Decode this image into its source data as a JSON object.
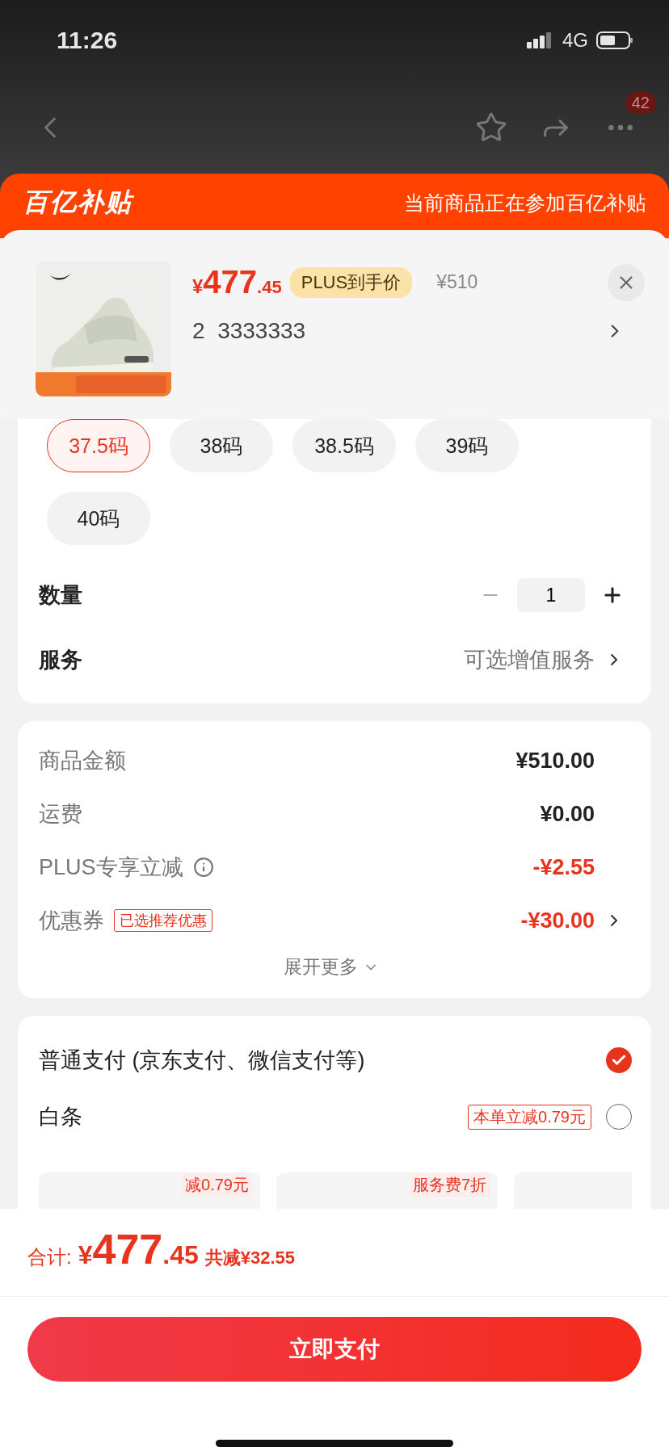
{
  "status_bar": {
    "time": "11:26",
    "network": "4G"
  },
  "nav": {
    "badge": "42"
  },
  "banner": {
    "logo": "百亿补贴",
    "text": "当前商品正在参加百亿补贴"
  },
  "product": {
    "currency": "¥",
    "price_int": "477",
    "price_dec": ".45",
    "price_tag": "PLUS到手价",
    "original_price": "¥510",
    "spec": "2  3333333"
  },
  "sizes": [
    {
      "label": "37.5码",
      "selected": true
    },
    {
      "label": "38码",
      "selected": false
    },
    {
      "label": "38.5码",
      "selected": false
    },
    {
      "label": "39码",
      "selected": false
    },
    {
      "label": "40码",
      "selected": false
    }
  ],
  "quantity": {
    "label": "数量",
    "value": "1"
  },
  "service": {
    "label": "服务",
    "value": "可选增值服务"
  },
  "summary": [
    {
      "label": "商品金额",
      "value": "¥510.00",
      "highlight": false
    },
    {
      "label": "运费",
      "value": "¥0.00",
      "highlight": false
    },
    {
      "label": "PLUS专享立减",
      "value": "-¥2.55",
      "highlight": true,
      "info": true
    },
    {
      "label": "优惠券",
      "tag": "已选推荐优惠",
      "value": "-¥30.00",
      "highlight": true,
      "arrow": true
    }
  ],
  "expand": "展开更多",
  "payment": [
    {
      "label": "普通支付 (京东支付、微信支付等)",
      "selected": true
    },
    {
      "label": "白条",
      "tag": "本单立减0.79元",
      "selected": false
    }
  ],
  "installments": [
    {
      "badge": "减0.79元"
    },
    {
      "badge": "服务费7折"
    }
  ],
  "footer": {
    "total_label": "合计:",
    "currency": "¥",
    "total_int": "477",
    "total_dec": ".45",
    "saving": "共减¥32.55",
    "button": "立即支付"
  }
}
